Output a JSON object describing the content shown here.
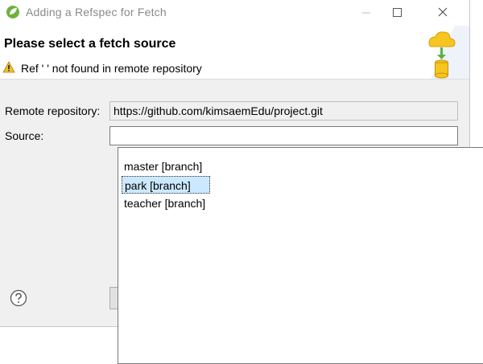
{
  "window": {
    "title": "Adding a Refspec for Fetch"
  },
  "header": {
    "title": "Please select a fetch source",
    "warning": "Ref ' ' not found in remote repository"
  },
  "form": {
    "remote_label": "Remote repository:",
    "remote_value": "https://github.com/kimsaemEdu/project.git",
    "source_label": "Source:",
    "source_value": ""
  },
  "dropdown": {
    "items": [
      "master [branch]",
      "park [branch]",
      "teacher [branch]"
    ],
    "selected": "park [branch]"
  },
  "colors": {
    "selection": "#cce8ff",
    "warning": "#f0c030",
    "accent_green": "#6db33f"
  }
}
